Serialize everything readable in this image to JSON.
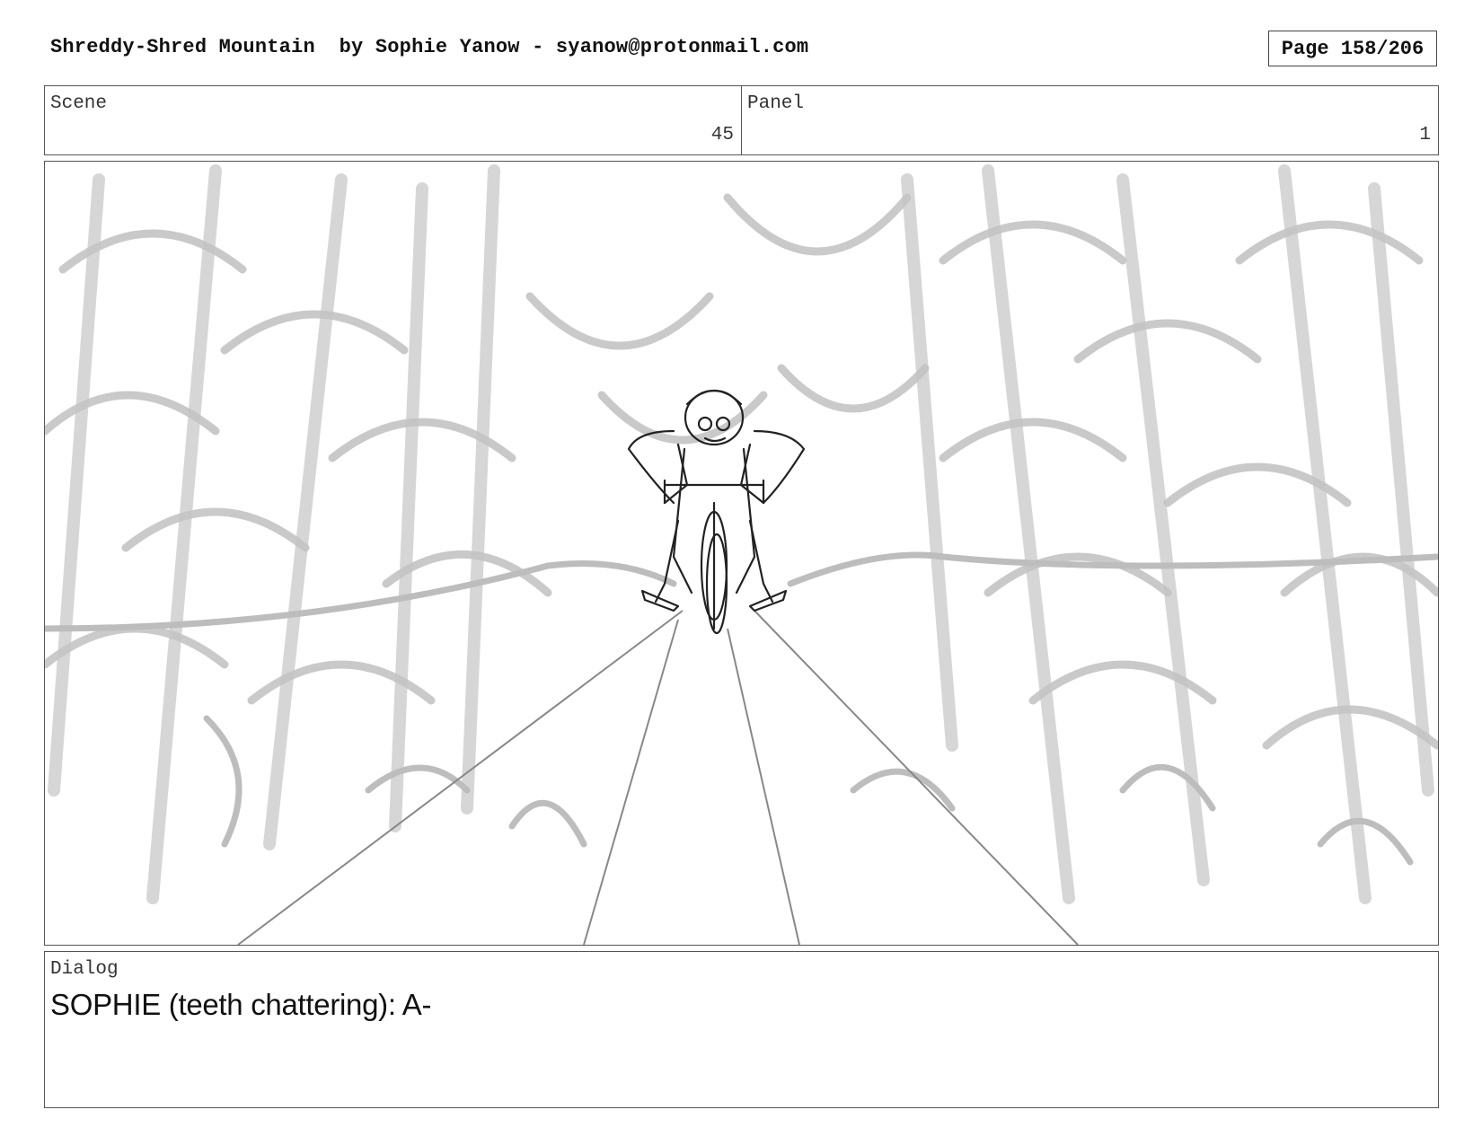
{
  "header": {
    "title": "Shreddy-Shred Mountain  by Sophie Yanow - syanow@protonmail.com",
    "page": "Page 158/206"
  },
  "info": {
    "scene_label": "Scene",
    "scene_value": "45",
    "panel_label": "Panel",
    "panel_value": "1"
  },
  "panel_image": {
    "description_icon": "storyboard-sketch-cyclist-forest-trail"
  },
  "dialog": {
    "label": "Dialog",
    "text": "SOPHIE (teeth chattering): A-"
  }
}
